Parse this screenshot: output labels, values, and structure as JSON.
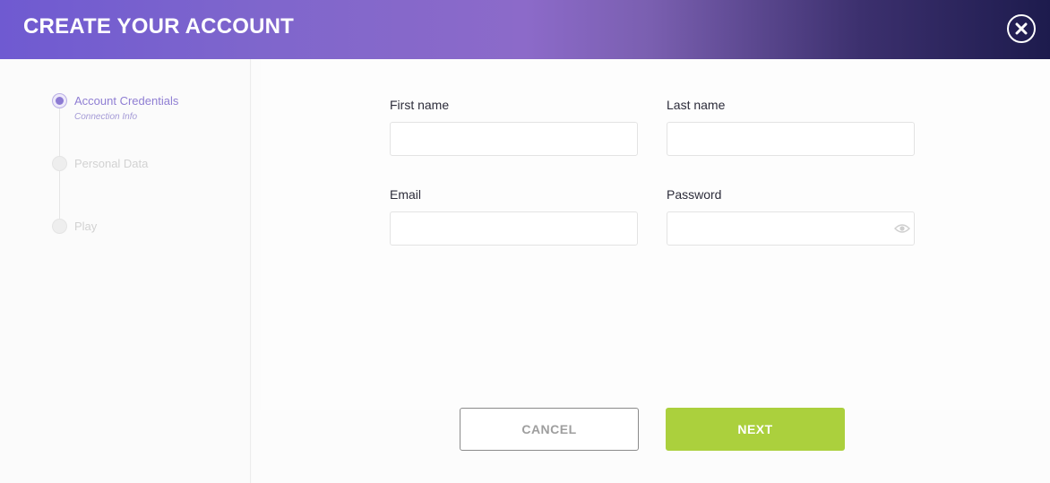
{
  "header": {
    "title": "CREATE YOUR ACCOUNT"
  },
  "steps": [
    {
      "label": "Account Credentials",
      "sub": "Connection Info",
      "state": "active"
    },
    {
      "label": "Personal Data",
      "state": "inactive"
    },
    {
      "label": "Play",
      "state": "inactive"
    }
  ],
  "form": {
    "first_name": {
      "label": "First name",
      "value": ""
    },
    "last_name": {
      "label": "Last name",
      "value": ""
    },
    "email": {
      "label": "Email",
      "value": ""
    },
    "password": {
      "label": "Password",
      "value": ""
    }
  },
  "buttons": {
    "cancel_label": "CANCEL",
    "next_label": "NEXT"
  },
  "icons": {
    "close": "close-icon",
    "password_toggle": "eye-icon"
  },
  "colors": {
    "accent": "#8c7ad3",
    "next_button": "#abd03d",
    "header_start": "#6f5ad1",
    "header_end": "#1d1b4d"
  }
}
